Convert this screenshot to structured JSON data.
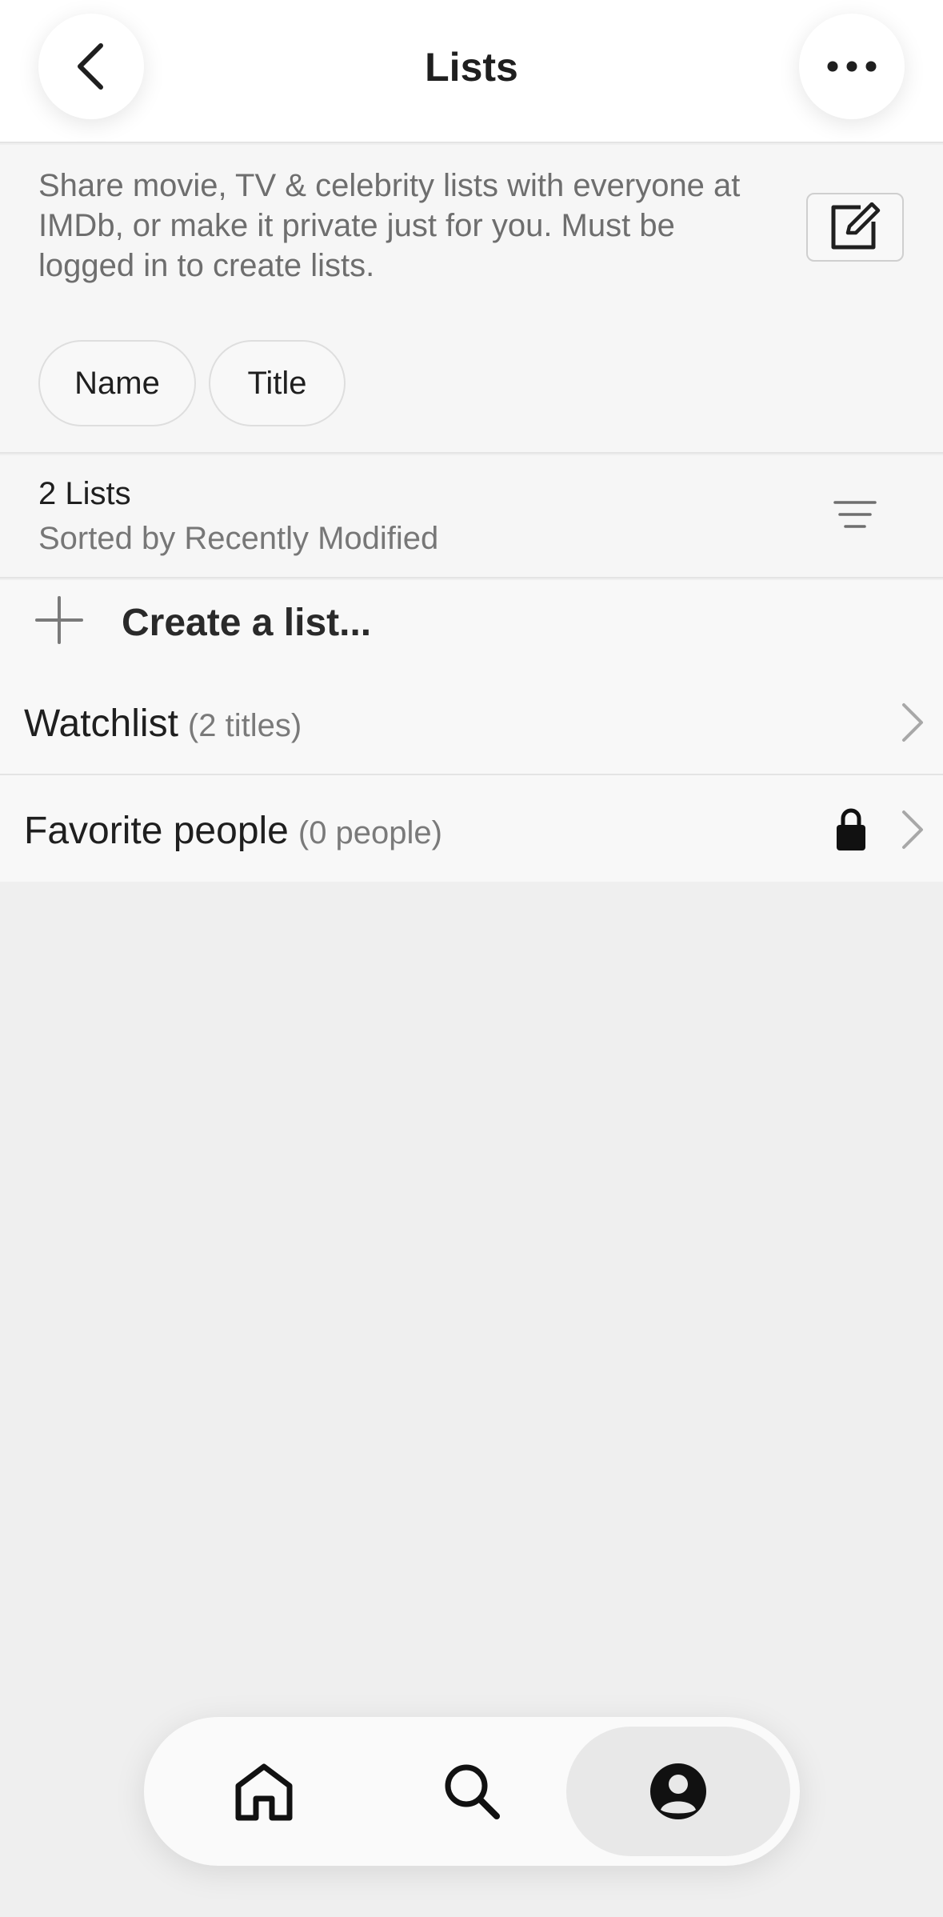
{
  "header": {
    "title": "Lists",
    "back_icon": "chevron-left-icon",
    "more_icon": "more-horizontal-icon"
  },
  "intro": {
    "text": "Share movie, TV & celebrity lists with everyone at IMDb, or make it private just for you. Must be logged in to create lists.",
    "edit_icon": "compose-icon"
  },
  "filters": [
    {
      "label": "Name"
    },
    {
      "label": "Title"
    }
  ],
  "summary": {
    "count_label": "2 Lists",
    "sort_label": "Sorted by Recently Modified",
    "sort_icon": "sort-lines-icon"
  },
  "create": {
    "label": "Create a list..."
  },
  "lists": [
    {
      "title": "Watchlist",
      "count": "(2 titles)",
      "private": false
    },
    {
      "title": "Favorite people",
      "count": "(0 people)",
      "private": true
    }
  ],
  "nav": {
    "items": [
      {
        "icon": "home-icon",
        "active": false
      },
      {
        "icon": "search-icon",
        "active": false
      },
      {
        "icon": "profile-icon",
        "active": true
      }
    ]
  },
  "colors": {
    "header_bg": "#ffffff",
    "page_bg": "#efefef",
    "section_bg": "#f6f6f6",
    "text_primary": "#1f1f1f",
    "text_secondary": "#777777"
  }
}
